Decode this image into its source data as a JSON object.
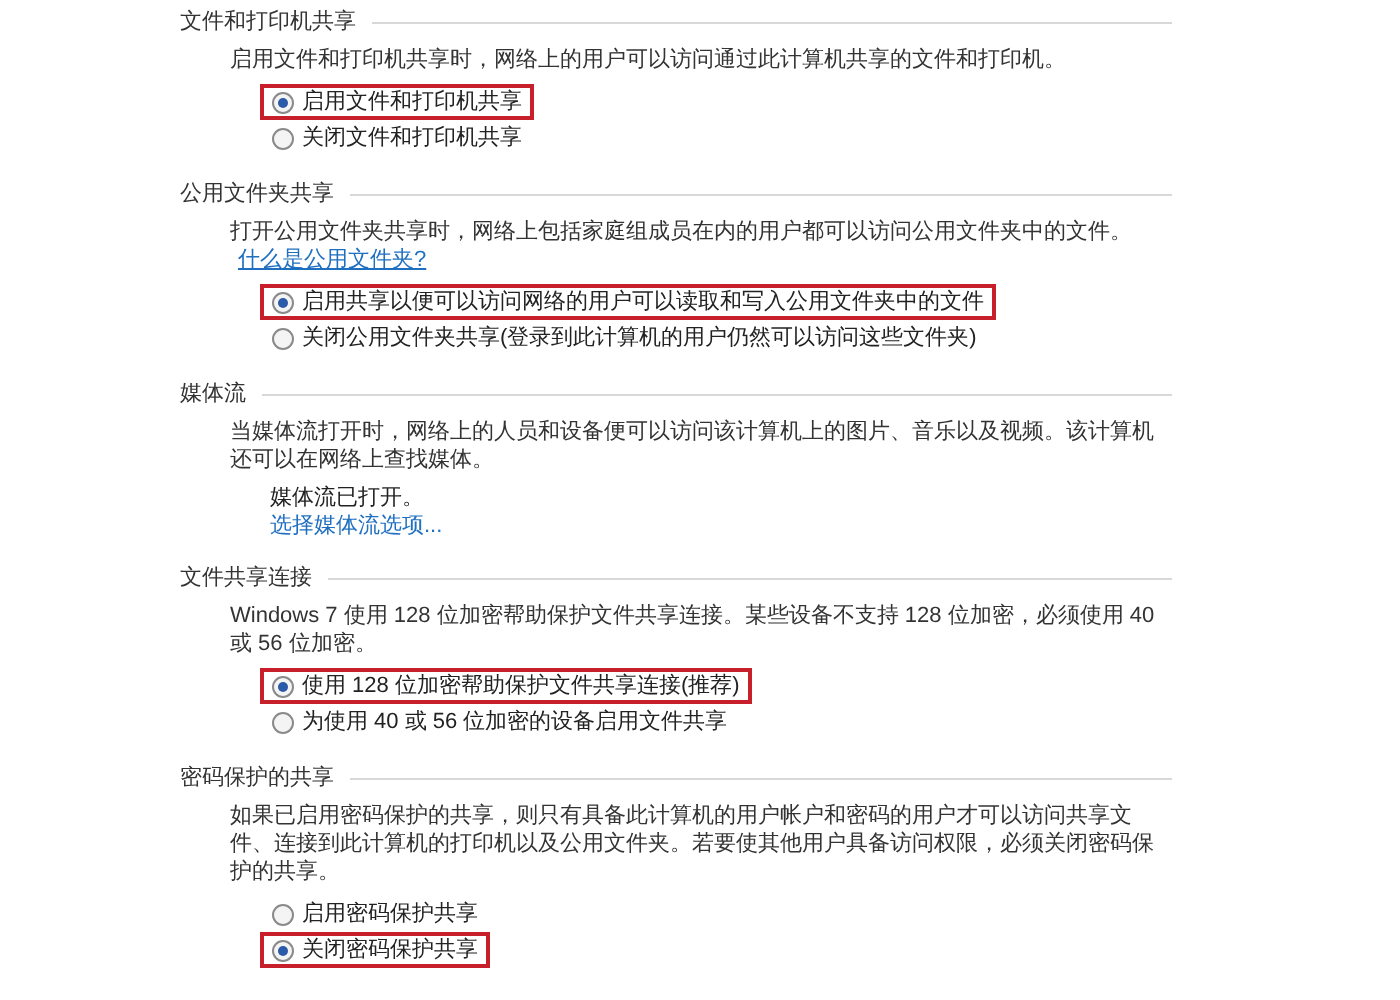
{
  "sections": [
    {
      "title": "文件和打印机共享",
      "description": "启用文件和打印机共享时，网络上的用户可以访问通过此计算机共享的文件和打印机。",
      "options": [
        {
          "label": "启用文件和打印机共享",
          "selected": true,
          "highlighted": true
        },
        {
          "label": "关闭文件和打印机共享",
          "selected": false,
          "highlighted": false
        }
      ]
    },
    {
      "title": "公用文件夹共享",
      "description": "打开公用文件夹共享时，网络上包括家庭组成员在内的用户都可以访问公用文件夹中的文件。",
      "link": "什么是公用文件夹?",
      "options": [
        {
          "label": "启用共享以便可以访问网络的用户可以读取和写入公用文件夹中的文件",
          "selected": true,
          "highlighted": true
        },
        {
          "label": "关闭公用文件夹共享(登录到此计算机的用户仍然可以访问这些文件夹)",
          "selected": false,
          "highlighted": false
        }
      ]
    },
    {
      "title": "媒体流",
      "description": "当媒体流打开时，网络上的人员和设备便可以访问该计算机上的图片、音乐以及视频。该计算机还可以在网络上查找媒体。",
      "status": "媒体流已打开。",
      "action_link": "选择媒体流选项..."
    },
    {
      "title": "文件共享连接",
      "description": "Windows 7 使用 128 位加密帮助保护文件共享连接。某些设备不支持 128 位加密，必须使用 40 或 56 位加密。",
      "options": [
        {
          "label": "使用 128 位加密帮助保护文件共享连接(推荐)",
          "selected": true,
          "highlighted": true
        },
        {
          "label": "为使用 40 或 56 位加密的设备启用文件共享",
          "selected": false,
          "highlighted": false
        }
      ]
    },
    {
      "title": "密码保护的共享",
      "description": "如果已启用密码保护的共享，则只有具备此计算机的用户帐户和密码的用户才可以访问共享文件、连接到此计算机的打印机以及公用文件夹。若要使其他用户具备访问权限，必须关闭密码保护的共享。",
      "options": [
        {
          "label": "启用密码保护共享",
          "selected": false,
          "highlighted": false
        },
        {
          "label": "关闭密码保护共享",
          "selected": true,
          "highlighted": true
        }
      ]
    }
  ]
}
